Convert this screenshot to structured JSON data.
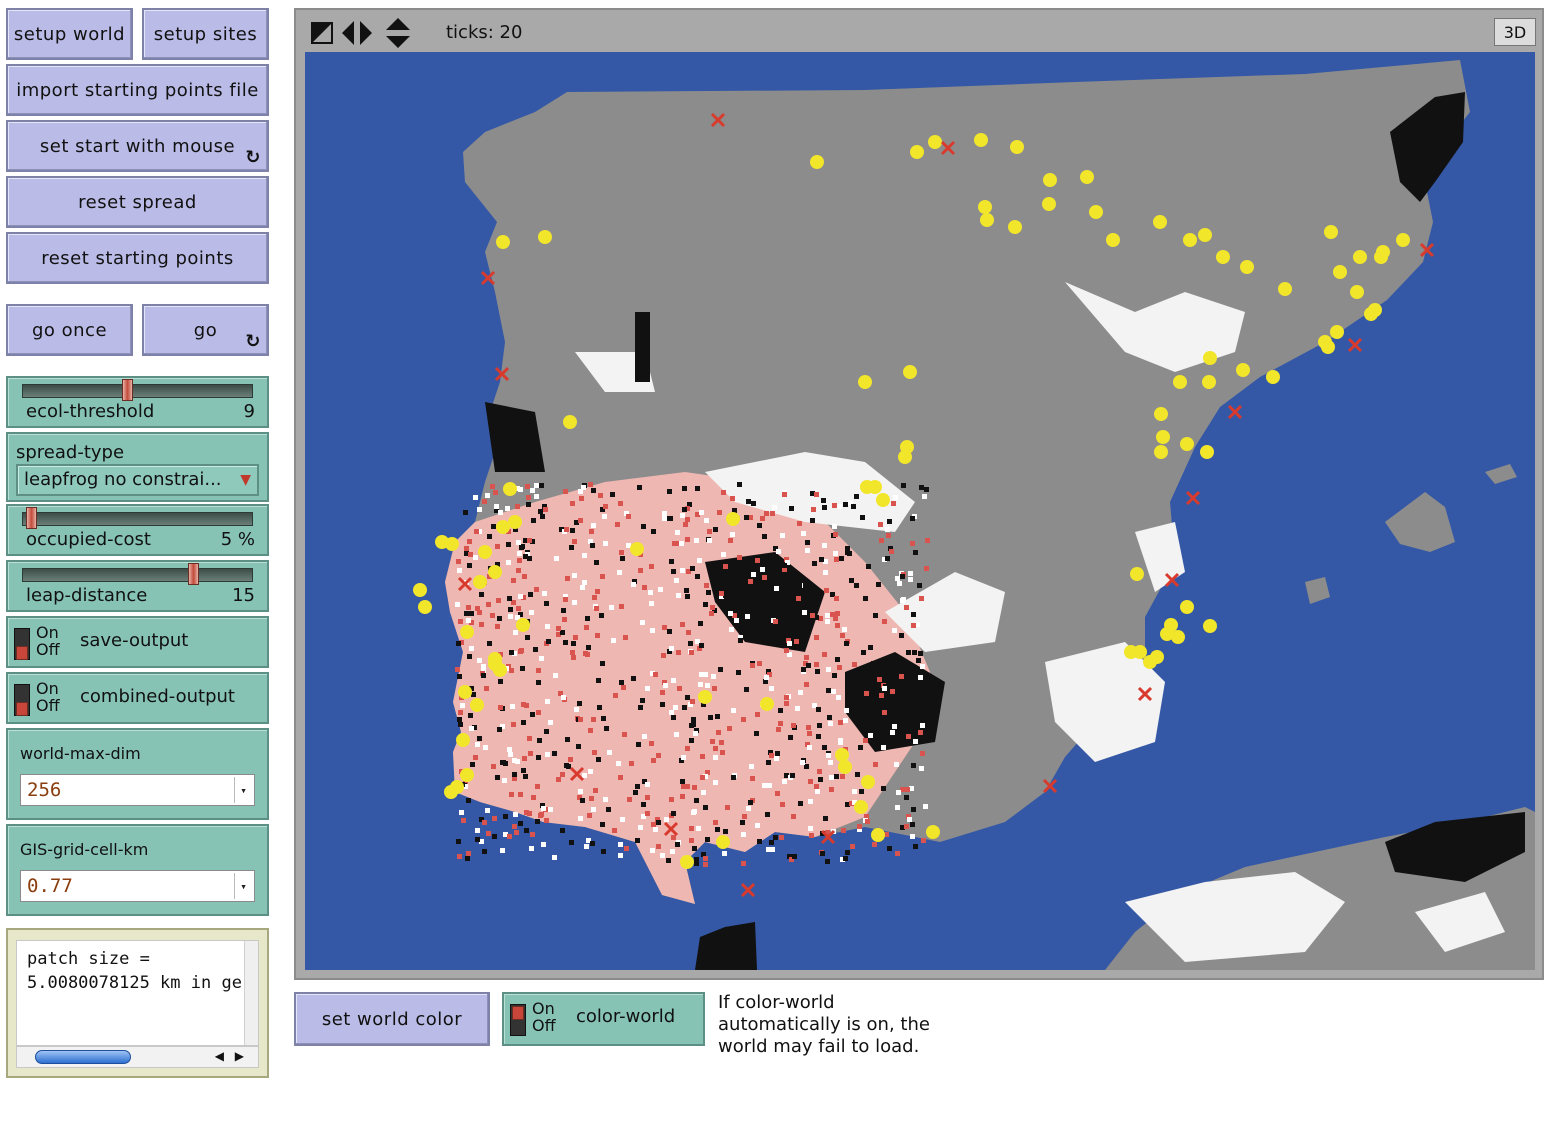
{
  "controls": {
    "setup_world": "setup world",
    "setup_sites": "setup sites",
    "import_starting_points": "import starting points file",
    "set_start_with_mouse": "set start with mouse",
    "reset_spread": "reset spread",
    "reset_starting_points": "reset starting points",
    "go_once": "go once",
    "go": "go",
    "forever_glyph": "↻"
  },
  "sliders": {
    "ecol_threshold": {
      "label": "ecol-threshold",
      "value": "9",
      "fraction": 0.44
    },
    "occupied_cost": {
      "label": "occupied-cost",
      "value": "5 %",
      "fraction": 0.03
    },
    "leap_distance": {
      "label": "leap-distance",
      "value": "15",
      "fraction": 0.73
    }
  },
  "chooser": {
    "label": "spread-type",
    "value": "leapfrog no constrai...",
    "arrow": "▼"
  },
  "switches": {
    "on_text": "On",
    "off_text": "Off",
    "save_output": {
      "label": "save-output",
      "state": "off"
    },
    "combined_output": {
      "label": "combined-output",
      "state": "off"
    },
    "color_world": {
      "label": "color-world",
      "state": "on"
    }
  },
  "inputs": {
    "world_max_dim": {
      "label": "world-max-dim",
      "value": "256"
    },
    "gis_grid_cell_km": {
      "label": "GIS-grid-cell-km",
      "value": "0.77"
    },
    "dropdown_arrow": "▾"
  },
  "output_area": {
    "line1": "patch size =",
    "line2": "5.0080078125 km in ge"
  },
  "view": {
    "ticks_label": "ticks: 20",
    "button_3d": "3D",
    "colors": {
      "sea": "#3458a6",
      "land": "#8c8c8c",
      "white_patch": "#ffffff",
      "black_patch": "#000000",
      "spread": "#e06b6b",
      "sites": "#f2e62a",
      "start_x": "#d93a2e"
    }
  },
  "set_world_color": "set world color",
  "note": {
    "line1": "If color-world",
    "line2": "automatically is on, the",
    "line3": "world may fail to load."
  }
}
